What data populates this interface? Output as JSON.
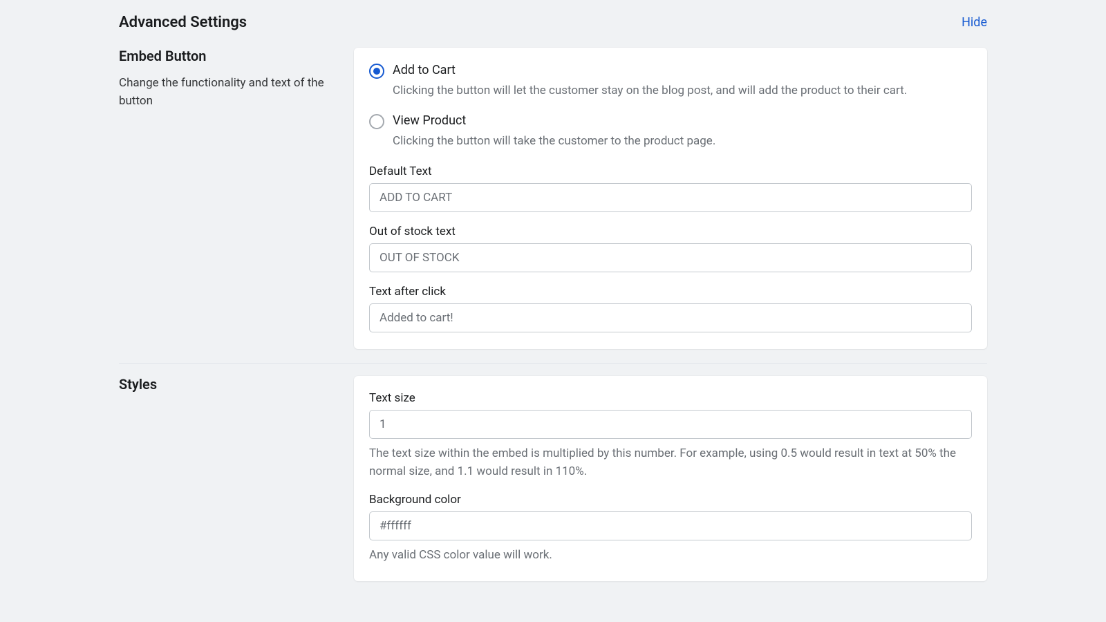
{
  "header": {
    "title": "Advanced Settings",
    "hide_label": "Hide"
  },
  "embed_button": {
    "heading": "Embed Button",
    "description": "Change the functionality and text of the button",
    "radio": {
      "add_to_cart": {
        "label": "Add to Cart",
        "sub": "Clicking the button will let the customer stay on the blog post, and will add the product to their cart."
      },
      "view_product": {
        "label": "View Product",
        "sub": "Clicking the button will take the customer to the product page."
      }
    },
    "fields": {
      "default_text": {
        "label": "Default Text",
        "value": "ADD TO CART"
      },
      "out_of_stock": {
        "label": "Out of stock text",
        "value": "OUT OF STOCK"
      },
      "after_click": {
        "label": "Text after click",
        "value": "Added to cart!"
      }
    }
  },
  "styles": {
    "heading": "Styles",
    "fields": {
      "text_size": {
        "label": "Text size",
        "value": "1",
        "help": "The text size within the embed is multiplied by this number. For example, using 0.5 would result in text at 50% the normal size, and 1.1 would result in 110%."
      },
      "background_color": {
        "label": "Background color",
        "value": "#ffffff",
        "help": "Any valid CSS color value will work."
      }
    }
  }
}
